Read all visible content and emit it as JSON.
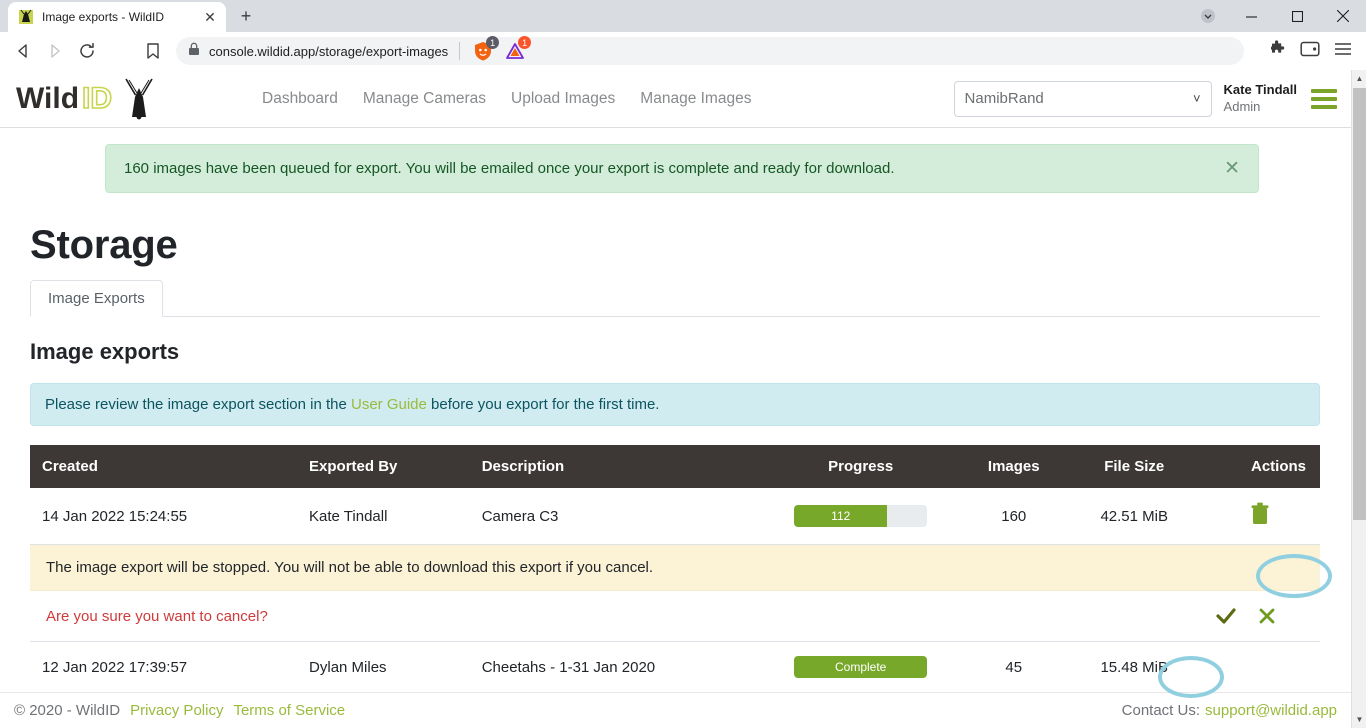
{
  "browser": {
    "tab": {
      "title": "Image exports - WildID",
      "favicon_icon": "wildid-favicon",
      "close_icon": "close-icon"
    },
    "new_tab_icon": "plus-icon",
    "window_controls": {
      "chevron_icon": "chevron-down-icon",
      "minimize_icon": "minimize-icon",
      "maximize_icon": "maximize-icon",
      "close_icon": "window-close-icon"
    },
    "nav": {
      "back_icon": "back-arrow-icon",
      "forward_icon": "forward-arrow-icon",
      "reload_icon": "reload-icon",
      "bookmark_icon": "bookmark-icon"
    },
    "url": "console.wildid.app/storage/export-images",
    "lock_icon": "lock-icon",
    "shields": {
      "icon": "brave-shields-lion-icon",
      "count": "1",
      "badge_color": "#5c5c66"
    },
    "rewards": {
      "icon": "brave-rewards-triangle-icon",
      "count": "1",
      "badge_color": "#fb542b"
    },
    "extensions_icon": "puzzle-piece-icon",
    "wallet_icon": "brave-wallet-icon",
    "menu_icon": "hamburger-menu-icon"
  },
  "app": {
    "logo": {
      "word_wild": "Wild",
      "word_id": "ID",
      "icon": "oryx-antelope-icon"
    },
    "nav_links": [
      "Dashboard",
      "Manage Cameras",
      "Upload Images",
      "Manage Images"
    ],
    "org_select": {
      "value": "NamibRand",
      "chevron_icon": "chevron-down-icon"
    },
    "user": {
      "name": "Kate Tindall",
      "role": "Admin"
    },
    "menu_icon": "hamburger-menu-icon"
  },
  "alerts": {
    "success": {
      "message": "160 images have been queued for export. You will be emailed once your export is complete and ready for download.",
      "close_icon": "close-icon",
      "bg_color": "#d4edda",
      "text_color": "#155724"
    },
    "info": {
      "prefix": "Please review the image export section in the ",
      "link": "User Guide",
      "suffix": " before you export for the first time.",
      "bg_color": "#d1ecf1",
      "link_color": "#9aba3c"
    }
  },
  "page": {
    "title": "Storage",
    "tabs": [
      {
        "label": "Image Exports",
        "active": true
      }
    ],
    "section_title": "Image exports"
  },
  "table": {
    "headers": [
      "Created",
      "Exported By",
      "Description",
      "Progress",
      "Images",
      "File Size",
      "Actions"
    ],
    "header_bg": "#3d3835",
    "rows": [
      {
        "created": "14 Jan 2022 15:24:55",
        "exported_by": "Kate Tindall",
        "description": "Camera C3",
        "progress": {
          "label": "112",
          "percent": 70,
          "complete": false
        },
        "images": "160",
        "file_size": "42.51 MiB",
        "action_icon": "trash-delete-icon"
      },
      {
        "created": "12 Jan 2022 17:39:57",
        "exported_by": "Dylan Miles",
        "description": "Cheetahs - 1-31 Jan 2020",
        "progress": {
          "label": "Complete",
          "percent": 100,
          "complete": true
        },
        "images": "45",
        "file_size": "15.48 MiB",
        "action_icon": ""
      }
    ],
    "progress_color": "#77a82a"
  },
  "cancel_confirm": {
    "warning": "The image export will be stopped. You will not be able to download this export if you cancel.",
    "warning_bg": "#fcf3d7",
    "question": "Are you sure you want to cancel?",
    "question_color": "#cf3a3a",
    "confirm_icon": "check-confirm-icon",
    "dismiss_icon": "x-dismiss-icon"
  },
  "annotations": {
    "color": "#8fcfe0",
    "items": [
      "delete-export-highlight",
      "confirm-cancel-highlight"
    ]
  },
  "footer": {
    "copyright": "© 2020 - WildID",
    "links": [
      "Privacy Policy",
      "Terms of Service"
    ],
    "contact_label": "Contact Us:",
    "contact_email": "support@wildid.app"
  },
  "scrollbar": {
    "up_icon": "scroll-up-arrow-icon",
    "down_icon": "scroll-down-arrow-icon"
  }
}
